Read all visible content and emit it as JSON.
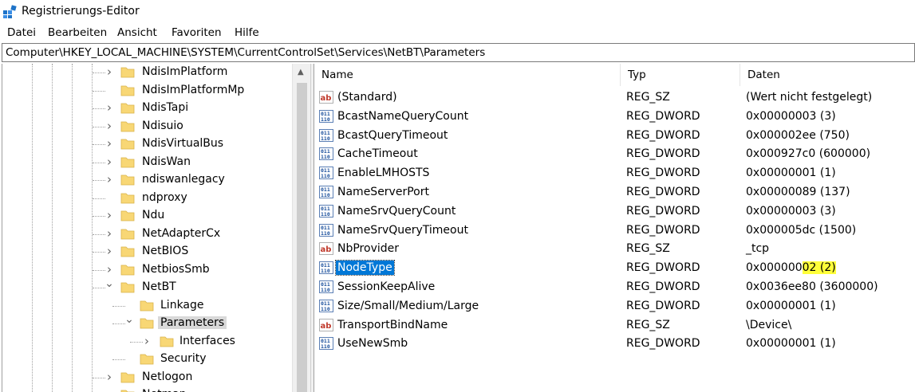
{
  "window": {
    "title": "Registrierungs-Editor"
  },
  "menu": [
    {
      "label": "Datei"
    },
    {
      "label": "Bearbeiten"
    },
    {
      "label": "Ansicht"
    },
    {
      "label": "Favoriten"
    },
    {
      "label": "Hilfe"
    }
  ],
  "address": {
    "path": "Computer\\HKEY_LOCAL_MACHINE\\SYSTEM\\CurrentControlSet\\Services\\NetBT\\Parameters"
  },
  "tree": [
    {
      "label": "NdisImPlatform",
      "level": 0,
      "expander": "collapsed"
    },
    {
      "label": "NdisImPlatformMp",
      "level": 0,
      "expander": "none"
    },
    {
      "label": "NdisTapi",
      "level": 0,
      "expander": "collapsed"
    },
    {
      "label": "Ndisuio",
      "level": 0,
      "expander": "collapsed"
    },
    {
      "label": "NdisVirtualBus",
      "level": 0,
      "expander": "collapsed"
    },
    {
      "label": "NdisWan",
      "level": 0,
      "expander": "collapsed"
    },
    {
      "label": "ndiswanlegacy",
      "level": 0,
      "expander": "collapsed"
    },
    {
      "label": "ndproxy",
      "level": 0,
      "expander": "none"
    },
    {
      "label": "Ndu",
      "level": 0,
      "expander": "collapsed"
    },
    {
      "label": "NetAdapterCx",
      "level": 0,
      "expander": "collapsed"
    },
    {
      "label": "NetBIOS",
      "level": 0,
      "expander": "collapsed"
    },
    {
      "label": "NetbiosSmb",
      "level": 0,
      "expander": "collapsed"
    },
    {
      "label": "NetBT",
      "level": 0,
      "expander": "expanded"
    },
    {
      "label": "Linkage",
      "level": 1,
      "expander": "none"
    },
    {
      "label": "Parameters",
      "level": 1,
      "expander": "expanded",
      "selected": true
    },
    {
      "label": "Interfaces",
      "level": 2,
      "expander": "collapsed"
    },
    {
      "label": "Security",
      "level": 1,
      "expander": "none"
    },
    {
      "label": "Netlogon",
      "level": 0,
      "expander": "collapsed"
    },
    {
      "label": "Netman",
      "level": 0,
      "expander": "collapsed"
    }
  ],
  "columns": {
    "name": "Name",
    "type": "Typ",
    "data": "Daten"
  },
  "values": [
    {
      "name": "(Standard)",
      "type": "REG_SZ",
      "data": "(Wert nicht festgelegt)",
      "icon": "string-value-icon"
    },
    {
      "name": "BcastNameQueryCount",
      "type": "REG_DWORD",
      "data": "0x00000003 (3)",
      "icon": "binary-value-icon"
    },
    {
      "name": "BcastQueryTimeout",
      "type": "REG_DWORD",
      "data": "0x000002ee (750)",
      "icon": "binary-value-icon"
    },
    {
      "name": "CacheTimeout",
      "type": "REG_DWORD",
      "data": "0x000927c0 (600000)",
      "icon": "binary-value-icon"
    },
    {
      "name": "EnableLMHOSTS",
      "type": "REG_DWORD",
      "data": "0x00000001 (1)",
      "icon": "binary-value-icon"
    },
    {
      "name": "NameServerPort",
      "type": "REG_DWORD",
      "data": "0x00000089 (137)",
      "icon": "binary-value-icon"
    },
    {
      "name": "NameSrvQueryCount",
      "type": "REG_DWORD",
      "data": "0x00000003 (3)",
      "icon": "binary-value-icon"
    },
    {
      "name": "NameSrvQueryTimeout",
      "type": "REG_DWORD",
      "data": "0x000005dc (1500)",
      "icon": "binary-value-icon"
    },
    {
      "name": "NbProvider",
      "type": "REG_SZ",
      "data": "_tcp",
      "icon": "string-value-icon"
    },
    {
      "name": "NodeType",
      "type": "REG_DWORD",
      "data_prefix": "0x000000",
      "data_highlight": "02 (2)",
      "icon": "binary-value-icon",
      "selected": true
    },
    {
      "name": "SessionKeepAlive",
      "type": "REG_DWORD",
      "data": "0x0036ee80 (3600000)",
      "icon": "binary-value-icon"
    },
    {
      "name": "Size/Small/Medium/Large",
      "type": "REG_DWORD",
      "data": "0x00000001 (1)",
      "icon": "binary-value-icon"
    },
    {
      "name": "TransportBindName",
      "type": "REG_SZ",
      "data": "\\Device\\",
      "icon": "string-value-icon"
    },
    {
      "name": "UseNewSmb",
      "type": "REG_DWORD",
      "data": "0x00000001 (1)",
      "icon": "binary-value-icon"
    }
  ],
  "colors": {
    "selection": "#0078d7",
    "highlight": "#ffff3a",
    "folder": "#f8d775"
  }
}
